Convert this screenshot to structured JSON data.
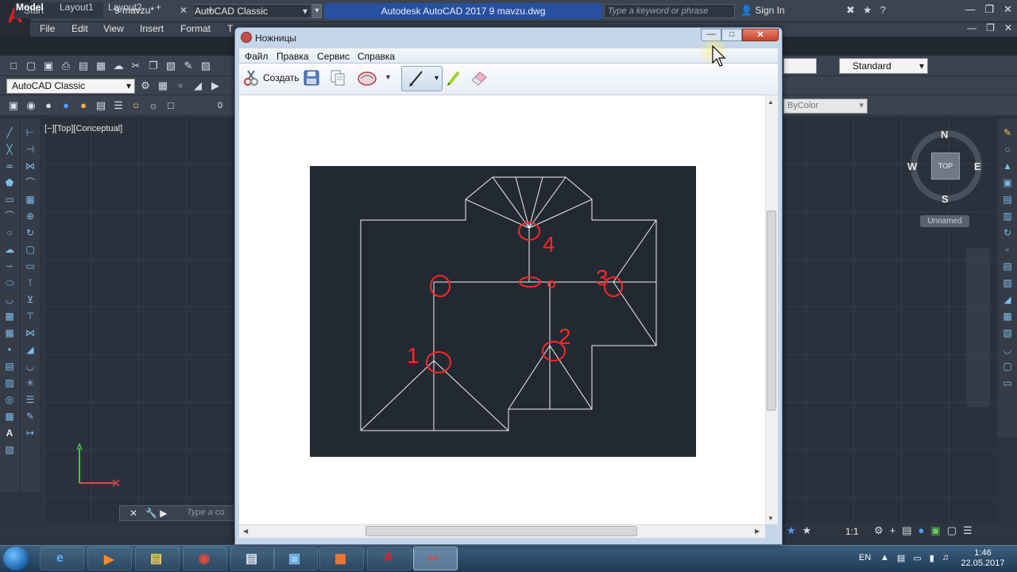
{
  "autocad": {
    "logo_letter": "A",
    "workspace_top": "AutoCAD Classic",
    "window_title": "Autodesk AutoCAD 2017    9 mavzu.dwg",
    "search_placeholder": "Type a keyword or phrase",
    "sign_in": "Sign In",
    "menu": [
      "File",
      "Edit",
      "View",
      "Insert",
      "Format",
      "T"
    ],
    "tabs": {
      "start": "Start",
      "document": "9 mavzu*",
      "add": "+"
    },
    "workspace_toolbar": "AutoCAD Classic",
    "text_style": "Standard",
    "layer_value": "0",
    "color_value": "ByColor",
    "view_label": "[−][Top][Conceptual]",
    "viewcube": {
      "top": "TOP",
      "north": "N",
      "south": "S",
      "east": "E",
      "west": "W",
      "ucs_name": "Unnamed"
    },
    "command_placeholder": "Type a co",
    "layout_tabs": [
      "Model",
      "Layout1",
      "Layout2",
      "+"
    ],
    "scale": "1:1",
    "icons": [
      "gear-icon",
      "search-icon",
      "close-icon",
      "help-icon"
    ],
    "accent_color": "#27509e"
  },
  "snipping_tool": {
    "title": "Ножницы",
    "menu": [
      "Файл",
      "Правка",
      "Сервис",
      "Справка"
    ],
    "create_label": "Создать",
    "annotations": [
      "4",
      "0",
      "3",
      "1",
      "2"
    ]
  },
  "taskbar": {
    "language": "EN",
    "time": "1:46",
    "date": "22.05.2017"
  }
}
